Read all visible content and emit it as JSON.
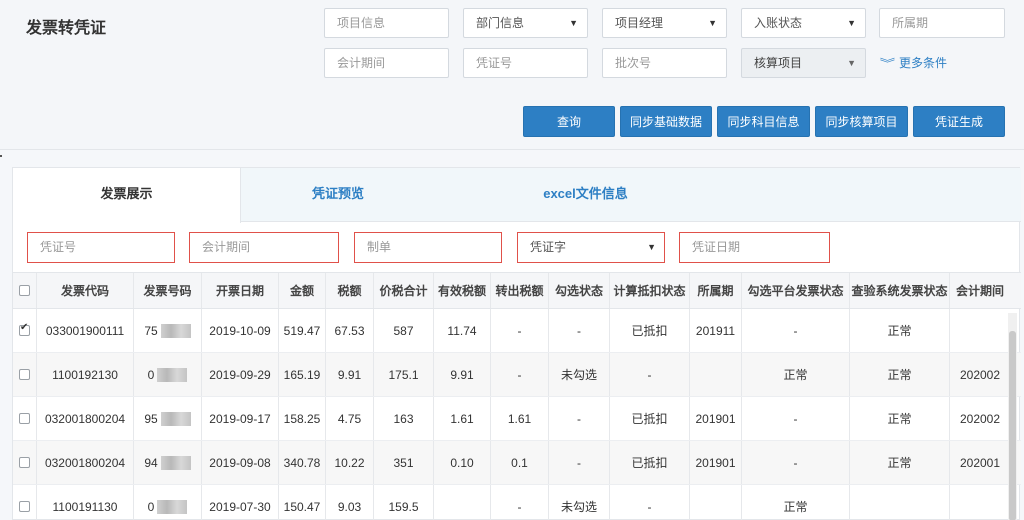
{
  "page": {
    "title": "发票转凭证"
  },
  "search": {
    "project_info": "项目信息",
    "department": "部门信息",
    "project_manager": "项目经理",
    "entry_status": "入账状态",
    "period": "所属期",
    "accounting_period": "会计期间",
    "voucher_no": "凭证号",
    "batch_no": "批次号",
    "accounting_item": "核算项目",
    "more_conditions": "更多条件"
  },
  "toolbar": {
    "query": "查询",
    "sync_basic": "同步基础数据",
    "sync_subject": "同步科目信息",
    "sync_accounting": "同步核算项目",
    "generate_voucher": "凭证生成"
  },
  "tabs": [
    "发票展示",
    "凭证预览",
    "excel文件信息"
  ],
  "filters": {
    "voucher_no": "凭证号",
    "accounting_period": "会计期间",
    "maker": "制单",
    "voucher_word": "凭证字",
    "voucher_date": "凭证日期"
  },
  "table": {
    "headers": [
      "发票代码",
      "发票号码",
      "开票日期",
      "金额",
      "税额",
      "价税合计",
      "有效税额",
      "转出税额",
      "勾选状态",
      "计算抵扣状态",
      "所属期",
      "勾选平台发票状态",
      "查验系统发票状态",
      "会计期间"
    ],
    "rows": [
      {
        "checked": true,
        "code": "033001900111",
        "number": "75",
        "date": "2019-10-09",
        "amount": "519.47",
        "tax": "67.53",
        "total": "587",
        "valid_tax": "11.74",
        "out_tax": "-",
        "select_status": "-",
        "deduct_status": "已抵扣",
        "period": "201911",
        "platform_status": "-",
        "check_status": "正常",
        "acc_period": ""
      },
      {
        "checked": false,
        "code": "1100192130",
        "number": "0",
        "date": "2019-09-29",
        "amount": "165.19",
        "tax": "9.91",
        "total": "175.1",
        "valid_tax": "9.91",
        "out_tax": "-",
        "select_status": "未勾选",
        "deduct_status": "-",
        "period": "",
        "platform_status": "正常",
        "check_status": "正常",
        "acc_period": "202002"
      },
      {
        "checked": false,
        "code": "032001800204",
        "number": "95",
        "date": "2019-09-17",
        "amount": "158.25",
        "tax": "4.75",
        "total": "163",
        "valid_tax": "1.61",
        "out_tax": "1.61",
        "select_status": "-",
        "deduct_status": "已抵扣",
        "period": "201901",
        "platform_status": "-",
        "check_status": "正常",
        "acc_period": "202002"
      },
      {
        "checked": false,
        "code": "032001800204",
        "number": "94",
        "date": "2019-09-08",
        "amount": "340.78",
        "tax": "10.22",
        "total": "351",
        "valid_tax": "0.10",
        "out_tax": "0.1",
        "select_status": "-",
        "deduct_status": "已抵扣",
        "period": "201901",
        "platform_status": "-",
        "check_status": "正常",
        "acc_period": "202001"
      },
      {
        "checked": false,
        "code": "1100191130",
        "number": "0",
        "date": "2019-07-30",
        "amount": "150.47",
        "tax": "9.03",
        "total": "159.5",
        "valid_tax": "",
        "out_tax": "-",
        "select_status": "未勾选",
        "deduct_status": "-",
        "period": "",
        "platform_status": "正常",
        "check_status": "",
        "acc_period": ""
      }
    ]
  }
}
